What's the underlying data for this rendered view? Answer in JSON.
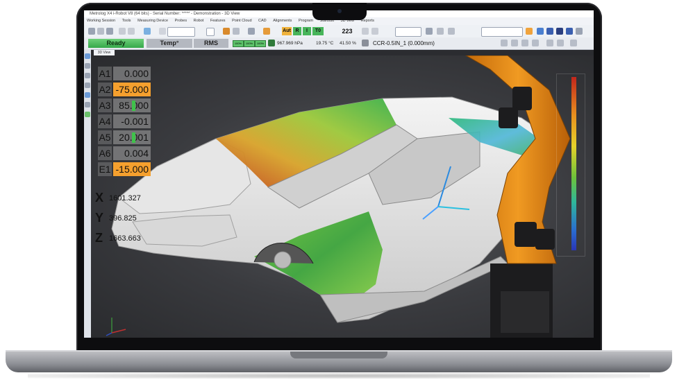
{
  "window": {
    "title": "Metrolog X4 i-Robot V8 (64 bits) - Serial Number: *****  - Demonstration - 3D View"
  },
  "menu": [
    "Working Session",
    "Tools",
    "Measuring Device",
    "Probes",
    "Robot",
    "Features",
    "Point Cloud",
    "CAD",
    "Alignments",
    "Program",
    "Stardust",
    "3D view",
    "Reports"
  ],
  "toolbar": {
    "auto_label": "Aut",
    "r_label": "R",
    "i_label": "I",
    "t0_label": "T0",
    "counter": "223"
  },
  "statusbar": {
    "ready_label": "Ready",
    "temp_label": "Temp°",
    "rms_label": "RMS",
    "pills": [
      "100%",
      "100%",
      "100%"
    ],
    "pressure": "967.969 hPa",
    "temperature": "19.75 °C",
    "humidity": "41.50 %",
    "probe": "CCR-0.5IN_1 (0.000mm)"
  },
  "view_tab": "3D View",
  "axes": [
    {
      "label": "A1",
      "value": "0.000",
      "highlight": false
    },
    {
      "label": "A2",
      "value": "-75.000",
      "highlight": true
    },
    {
      "label": "A3",
      "value": "85.000",
      "highlight": false
    },
    {
      "label": "A4",
      "value": "-0.001",
      "highlight": false
    },
    {
      "label": "A5",
      "value": "20.001",
      "highlight": false
    },
    {
      "label": "A6",
      "value": "0.004",
      "highlight": false
    },
    {
      "label": "E1",
      "value": "-15.000",
      "highlight": true
    }
  ],
  "coords": [
    {
      "label": "X",
      "value": "1601.327"
    },
    {
      "label": "Y",
      "value": "396.825"
    },
    {
      "label": "Z",
      "value": "1663.663"
    }
  ],
  "colors": {
    "robot": "#e8860f",
    "ready": "#3fb44f",
    "highlight": "#f5a02e"
  }
}
